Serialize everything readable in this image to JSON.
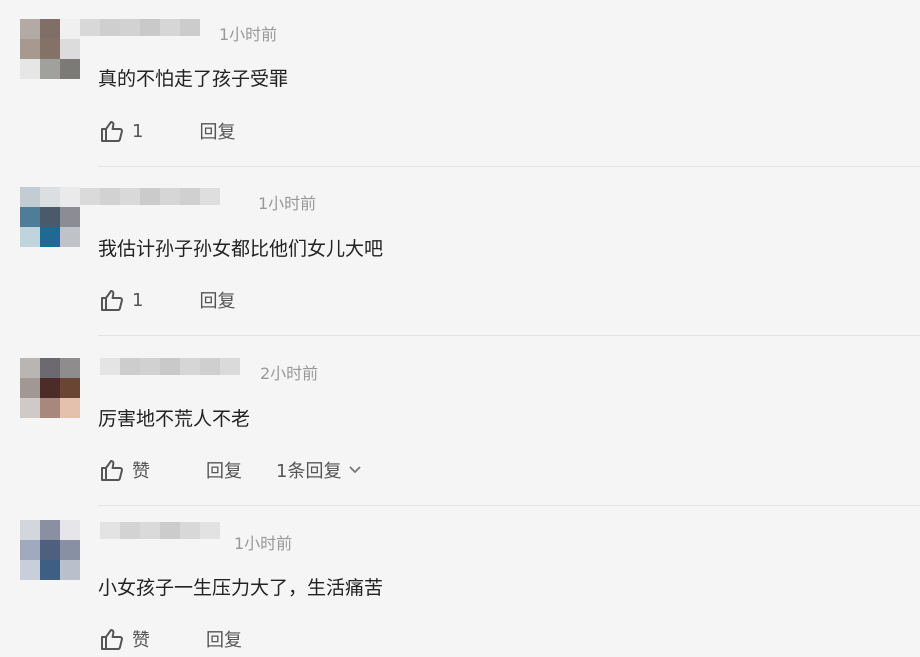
{
  "comments": [
    {
      "time": "1小时前",
      "text": "真的不怕走了孩子受罪",
      "like_count": "1",
      "reply_label": "回复",
      "avatar_colors": [
        "#b3aaa5",
        "#7f6f66",
        "#f0f0f0",
        "#a89990",
        "#857266",
        "#dcdcdc",
        "#e6e6e6",
        "#a0a09c",
        "#7c7a76"
      ],
      "name_colors": [
        "#d8d8d8",
        "#cfcfcf",
        "#d2d2d2",
        "#c9c9c9",
        "#d6d6d6",
        "#cccccc"
      ]
    },
    {
      "time": "1小时前",
      "text": "我估计孙子孙女都比他们女儿大吧",
      "like_count": "1",
      "reply_label": "回复",
      "avatar_colors": [
        "#c2ccd2",
        "#dcdfe2",
        "#ebeaea",
        "#4f7c96",
        "#4a5a6a",
        "#8c8c94",
        "#c0d4de",
        "#1f6a92",
        "#bfc2c6"
      ],
      "name_colors": [
        "#dadada",
        "#d2d2d2",
        "#d9d9d9",
        "#cbcbcb",
        "#d6d6d6",
        "#d0d0d0",
        "#dedede"
      ]
    },
    {
      "time": "2小时前",
      "text": "厉害地不荒人不老",
      "like_label": "赞",
      "reply_label": "回复",
      "more_replies": "1条回复",
      "avatar_colors": [
        "#b9b5b3",
        "#6c6a70",
        "#8e8c8c",
        "#a19793",
        "#4b2c28",
        "#6b4534",
        "#cfcac8",
        "#a8887d",
        "#e4c1ad"
      ],
      "name_colors": [
        "#e4e4e4",
        "#cdcdcd",
        "#d1d1d1",
        "#c9c9c9",
        "#d6d6d6",
        "#cfcfcf",
        "#dadada"
      ]
    },
    {
      "time": "1小时前",
      "text": "小女孩子一生压力大了，生活痛苦",
      "like_label": "赞",
      "reply_label": "回复",
      "avatar_colors": [
        "#d4d6de",
        "#8a8fa2",
        "#e6e6ea",
        "#a0a9be",
        "#4f5f7e",
        "#8890a3",
        "#c9cfda",
        "#3e5f84",
        "#b9c0cc"
      ],
      "name_colors": [
        "#e3e3e3",
        "#d3d3d3",
        "#dadada",
        "#cccccc",
        "#d8d8d8",
        "#e2e2e2"
      ]
    }
  ]
}
